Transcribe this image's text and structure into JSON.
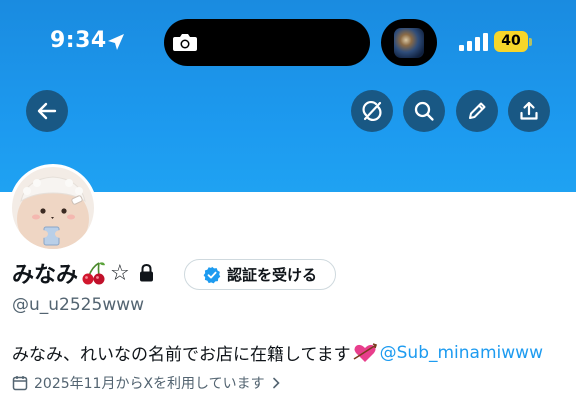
{
  "status_bar": {
    "time": "9:34",
    "battery": "40"
  },
  "nav": {
    "back_icon": "arrow-left-icon",
    "actions": [
      "circle-arrows-icon",
      "search-icon",
      "pencil-icon",
      "share-icon"
    ]
  },
  "profile": {
    "display_name": "みなみ",
    "handle": "@u_u2525www",
    "star": "☆",
    "verify_button": "認証を受ける",
    "bio_text": "みなみ、れいなの名前でお店に在籍してます",
    "bio_mention": "@Sub_minamiwww",
    "joined": "2025年11月からXを利用しています"
  },
  "colors": {
    "banner": "#1d9bf0",
    "nav_button": "#195884",
    "mention": "#1d9bf0",
    "verified": "#1d9bf0",
    "battery": "#f7d62a"
  }
}
